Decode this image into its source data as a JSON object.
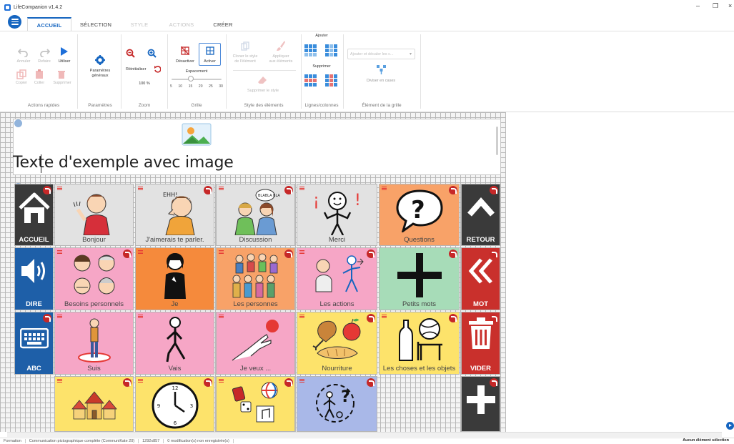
{
  "window": {
    "title": "LifeCompanion v1.4.2",
    "controls": {
      "minimize": "–",
      "restore": "❐",
      "close": "×"
    }
  },
  "tabs": [
    {
      "label": "ACCUEIL",
      "state": "active"
    },
    {
      "label": "SÉLECTION",
      "state": "normal"
    },
    {
      "label": "STYLE",
      "state": "disabled"
    },
    {
      "label": "ACTIONS",
      "state": "disabled"
    },
    {
      "label": "CRÉER",
      "state": "normal"
    }
  ],
  "ribbon": {
    "quick_actions": {
      "label": "Actions rapides",
      "undo": "Annuler",
      "redo": "Refaire",
      "use": "Utiliser",
      "copy": "Copier",
      "paste": "Coller",
      "delete": "Supprimer"
    },
    "settings": {
      "label": "Paramètres",
      "button_line1": "Paramètres",
      "button_line2": "généraux"
    },
    "zoom": {
      "label": "Zoom",
      "reset": "Réinitialiser",
      "value": "100 %"
    },
    "grid": {
      "label": "Grille",
      "deactivate": "Désactiver",
      "activate": "Activer",
      "spacing_label": "Espacement",
      "ticks": [
        "5",
        "10",
        "15",
        "20",
        "25",
        "30"
      ]
    },
    "style": {
      "label": "Style des éléments",
      "clone_line1": "Cloner le style",
      "clone_line2": "de l'élément",
      "apply_line1": "Appliquer",
      "apply_line2": "aux éléments",
      "remove": "Supprimer le style"
    },
    "rows_cols": {
      "label": "Lignes/colonnes",
      "add": "Ajouter",
      "remove": "Supprimer"
    },
    "grid_element": {
      "label": "Élément de la grille",
      "dropdown_placeholder": "Ajouter et décaler les c...",
      "split": "Diviser en cases"
    }
  },
  "editor": {
    "text": "Texte d'exemple avec image"
  },
  "cells": {
    "accueil": "ACCUEIL",
    "bonjour": "Bonjour",
    "parler": "J'aimerais te parler.",
    "discussion": "Discussion",
    "merci": "Merci",
    "questions": "Questions",
    "retour": "RETOUR",
    "dire": "DIRE",
    "besoins": "Besoins personnels",
    "je": "Je",
    "personnes": "Les personnes",
    "actions": "Les actions",
    "petits_mots": "Petits mots",
    "mot": "MOT",
    "abc": "ABC",
    "suis": "Suis",
    "vais": "Vais",
    "je_veux": "Je veux ...",
    "nourriture": "Nourriture",
    "choses": "Les choses et les objets",
    "vider": "VIDER",
    "bubble": "BLABLA BLA",
    "ehh": "EHH!"
  },
  "status": {
    "mode": "Formation",
    "config": "Communication pictographique complète (CommuniKate 20)",
    "resolution": "1292x857",
    "modifications": "0 modification(s) non enregistrée(s)",
    "selection": "Aucun élément sélection"
  },
  "colors": {
    "accent": "#1565c0",
    "nav": "#3a3a3a",
    "gray": "#e2e2e2",
    "pink": "#f6a6c6",
    "orange": "#f8a268",
    "deep_orange": "#f58a3c",
    "yellow": "#fde36b",
    "green": "#a7dcb8",
    "blue_nav": "#1e5fa8",
    "red_nav": "#c9302c",
    "lavender": "#a9b8e8"
  }
}
